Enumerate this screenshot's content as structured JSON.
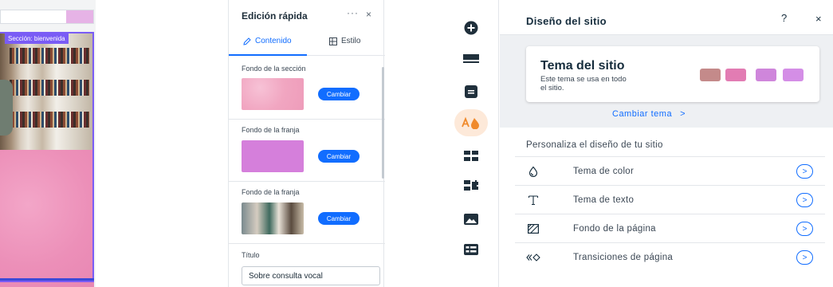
{
  "canvas": {
    "section_badge": "Sección: bienvenida"
  },
  "quick_edit": {
    "title": "Edición rápida",
    "more_label": "···",
    "close_label": "×",
    "tabs": [
      {
        "label": "Contenido",
        "icon": "pencil-icon",
        "active": true
      },
      {
        "label": "Estilo",
        "icon": "layout-icon",
        "active": false
      }
    ],
    "sections": [
      {
        "label": "Fondo de la sección",
        "swatch": "pink-texture",
        "button": "Cambiar"
      },
      {
        "label": "Fondo de la franja",
        "swatch": "#d57fdb",
        "button": "Cambiar"
      },
      {
        "label": "Fondo de la franja",
        "swatch": "photo",
        "button": "Cambiar"
      }
    ],
    "title_field_label": "Título",
    "title_field_value": "Sobre consulta vocal"
  },
  "rail": {
    "items": [
      {
        "icon": "add-icon",
        "active": false
      },
      {
        "icon": "menu-lines-icon",
        "active": false
      },
      {
        "icon": "page-icon",
        "active": false
      },
      {
        "icon": "theme-paint-icon",
        "active": true
      },
      {
        "icon": "apps-grid-icon",
        "active": false
      },
      {
        "icon": "puzzle-icon",
        "active": false
      },
      {
        "icon": "media-icon",
        "active": false
      },
      {
        "icon": "table-icon",
        "active": false
      }
    ]
  },
  "site_design": {
    "title": "Diseño del sitio",
    "help_label": "?",
    "close_label": "×",
    "theme_name": "Tema del sitio",
    "theme_desc": "Este tema se usa en todo el sitio.",
    "theme_colors": [
      "#c48a8a",
      "#e27cb3",
      "#cf86db",
      "#d48ee6"
    ],
    "change_theme_label": "Cambiar tema",
    "change_theme_arrow": ">",
    "customize_label": "Personaliza el diseño de tu sitio",
    "rows": [
      {
        "label": "Tema de color",
        "icon": "droplet-icon"
      },
      {
        "label": "Tema de texto",
        "icon": "text-icon"
      },
      {
        "label": "Fondo de la página",
        "icon": "page-background-icon"
      },
      {
        "label": "Transiciones de página",
        "icon": "transitions-icon"
      }
    ],
    "row_arrow": ">"
  }
}
